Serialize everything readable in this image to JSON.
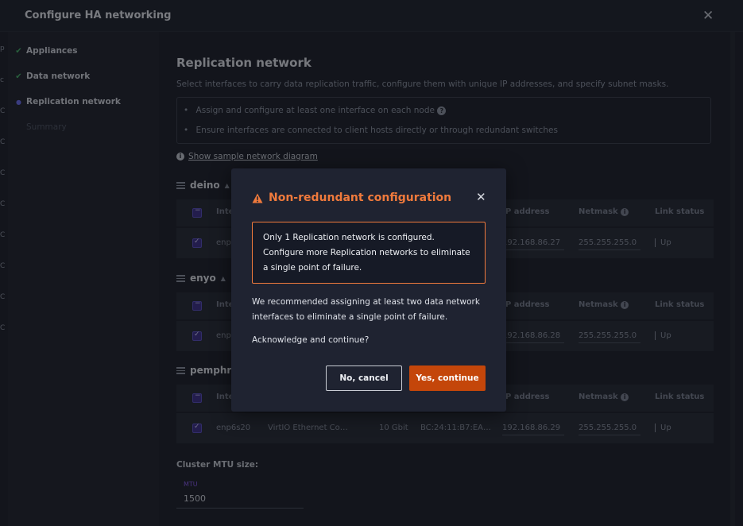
{
  "window": {
    "title": "Configure HA networking"
  },
  "left_edge_glyphs": [
    "p",
    "c",
    "C",
    "C",
    "C",
    "C",
    "C",
    "C",
    "C",
    "C",
    "C"
  ],
  "steps": [
    {
      "label": "Appliances",
      "state": "done"
    },
    {
      "label": "Data network",
      "state": "done"
    },
    {
      "label": "Replication network",
      "state": "current"
    },
    {
      "label": "Summary",
      "state": "pending"
    }
  ],
  "section": {
    "title": "Replication network",
    "description": "Select interfaces to carry data replication traffic, configure them with unique IP addresses, and specify subnet masks.",
    "info_items": [
      "Assign and configure at least one interface on each node",
      "Ensure interfaces are connected to client hosts directly or through redundant switches"
    ],
    "help_glyph": "?",
    "info_glyph": "i",
    "diagram_link": "Show sample network diagram"
  },
  "table_headers": {
    "interface": "Inte",
    "ip": "P address",
    "netmask": "Netmask",
    "link": "Link status"
  },
  "nodes": [
    {
      "name": "deino",
      "caret": "▲",
      "row": {
        "interface": "enp",
        "ip": "192.168.86.27",
        "netmask": "255.255.255.0",
        "status": "Up"
      }
    },
    {
      "name": "enyo",
      "caret": "▲",
      "row": {
        "interface": "enp",
        "ip": "192.168.86.28",
        "netmask": "255.255.255.0",
        "status": "Up"
      }
    },
    {
      "name": "pemphre",
      "caret": "",
      "row": {
        "interface": "enp6s20",
        "description": "VirtIO Ethernet Co…",
        "speed": "10 Gbit",
        "mac": "BC:24:11:B7:EA…",
        "ip": "192.168.86.29",
        "netmask": "255.255.255.0",
        "status": "Up"
      }
    }
  ],
  "mtu": {
    "label": "Cluster MTU size:",
    "field_label": "MTU",
    "value": "1500"
  },
  "modal": {
    "title": "Non-redundant configuration",
    "alert": "Only 1 Replication network is configured. Configure more Replication networks to eliminate a single point of failure.",
    "body": "We recommended assigning at least two data network interfaces to eliminate a single point of failure.",
    "question": "Acknowledge and continue?",
    "cancel_label": "No, cancel",
    "confirm_label": "Yes, continue",
    "accent_color": "#f07a3c",
    "button_color": "#c4460a"
  }
}
